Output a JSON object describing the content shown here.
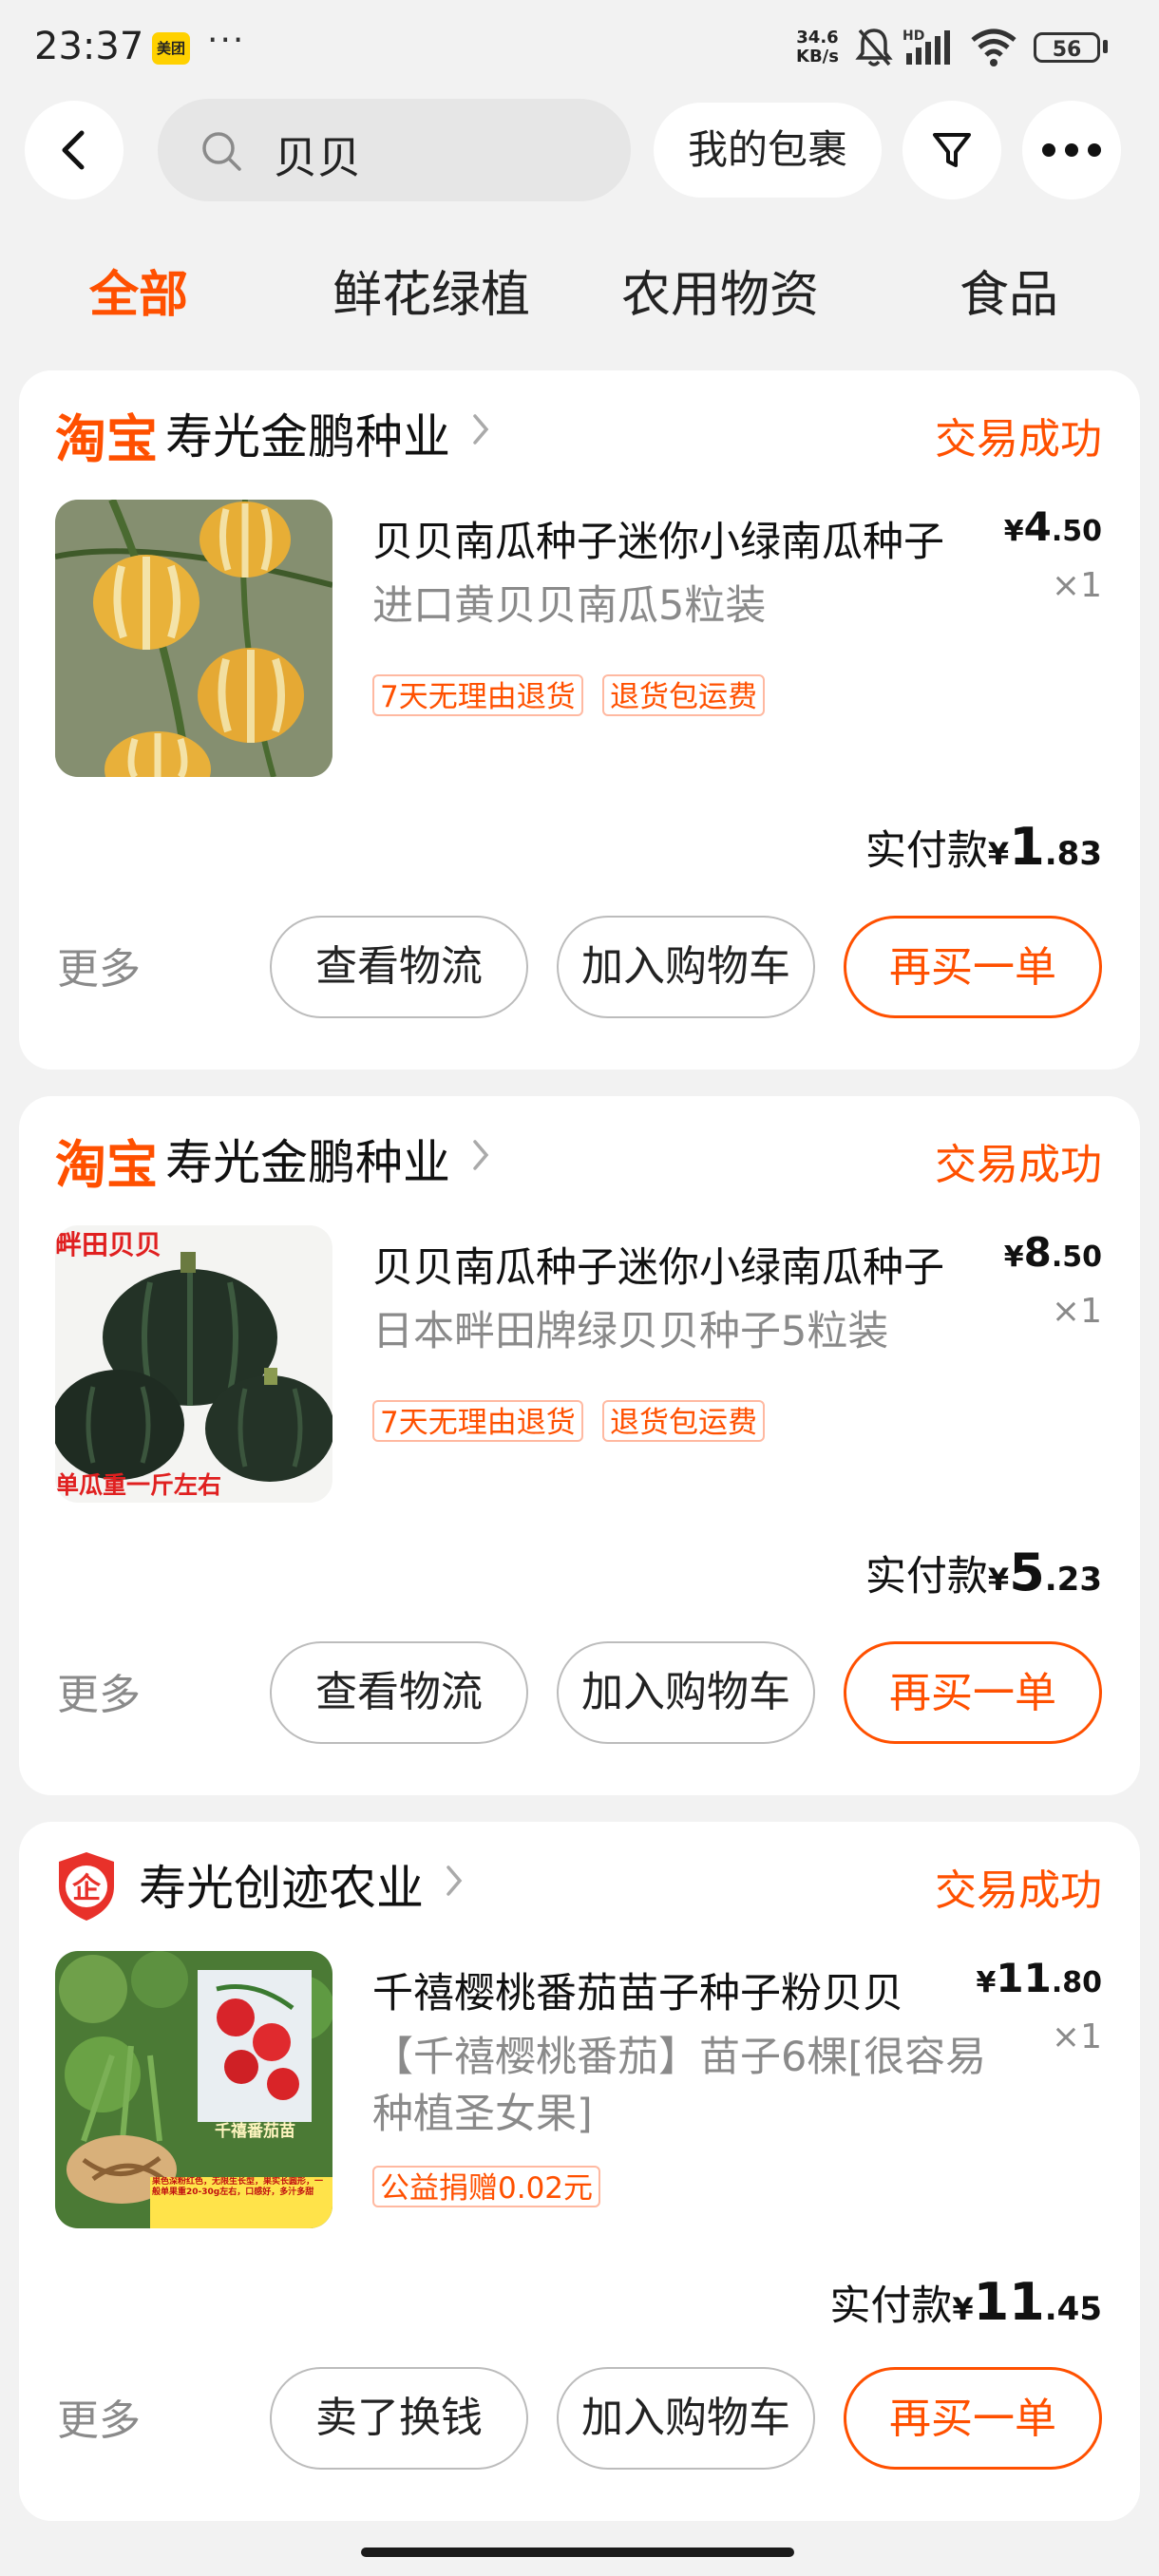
{
  "status_bar": {
    "time": "23:37",
    "app_badge": "美团",
    "more_dots": "···",
    "net_speed_value": "34.6",
    "net_speed_unit": "KB/s",
    "signal_label": "HD",
    "battery": "56"
  },
  "header": {
    "search_text": "贝贝",
    "my_parcel": "我的包裹"
  },
  "tabs": [
    {
      "label": "全部",
      "active": true
    },
    {
      "label": "鲜花绿植",
      "active": false
    },
    {
      "label": "农用物资",
      "active": false
    },
    {
      "label": "食品",
      "active": false
    }
  ],
  "orders": [
    {
      "platform": "淘宝",
      "shop": "寿光金鹏种业",
      "status": "交易成功",
      "title": "贝贝南瓜种子迷你小绿南瓜种子",
      "sku": "进口黄贝贝南瓜5粒装",
      "price_yen": "¥",
      "price_int": "4",
      "price_dec": ".50",
      "qty": "×1",
      "tags": [
        "7天无理由退货",
        "退货包运费"
      ],
      "paid_label": "实付款",
      "paid_yen": "¥",
      "paid_int": "1",
      "paid_dec": ".83",
      "more": "更多",
      "buttons": [
        "查看物流",
        "加入购物车",
        "再买一单"
      ]
    },
    {
      "platform": "淘宝",
      "shop": "寿光金鹏种业",
      "status": "交易成功",
      "title": "贝贝南瓜种子迷你小绿南瓜种子",
      "sku": "日本畔田牌绿贝贝种子5粒装",
      "image_text_top": "畔田贝贝",
      "image_text_bottom": "单瓜重一斤左右",
      "price_yen": "¥",
      "price_int": "8",
      "price_dec": ".50",
      "qty": "×1",
      "tags": [
        "7天无理由退货",
        "退货包运费"
      ],
      "paid_label": "实付款",
      "paid_yen": "¥",
      "paid_int": "5",
      "paid_dec": ".23",
      "more": "更多",
      "buttons": [
        "查看物流",
        "加入购物车",
        "再买一单"
      ]
    },
    {
      "platform_badge": "企",
      "shop": "寿光创迹农业",
      "status": "交易成功",
      "title": "千禧樱桃番茄苗子种子粉贝贝",
      "sku": "【千禧樱桃番茄】苗子6棵[很容易种植圣女果]",
      "image_label": "千禧番茄苗",
      "image_caption": "果色深粉红色，无限生长型，果实长圆形，一般单果重20-30g左右，口感好，多汁多甜",
      "price_yen": "¥",
      "price_int": "11",
      "price_dec": ".80",
      "qty": "×1",
      "tags": [
        "公益捐赠0.02元"
      ],
      "paid_label": "实付款",
      "paid_yen": "¥",
      "paid_int": "11",
      "paid_dec": ".45",
      "more": "更多",
      "buttons": [
        "卖了换钱",
        "加入购物车",
        "再买一单"
      ]
    }
  ],
  "colors": {
    "accent": "#ff5000",
    "background": "#f2f2f2",
    "card": "#ffffff",
    "muted_text": "#8a8a8a"
  }
}
